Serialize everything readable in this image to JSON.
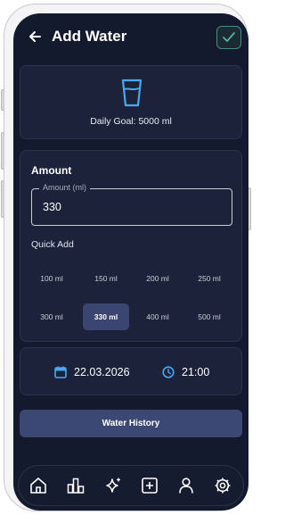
{
  "header": {
    "title": "Add Water",
    "back_icon": "arrow-left-icon",
    "confirm_icon": "check-icon"
  },
  "goal": {
    "icon": "water-glass-icon",
    "text": "Daily Goal: 5000 ml"
  },
  "amount": {
    "section_title": "Amount",
    "field_label": "Amount (ml)",
    "field_value": "330",
    "quick_add_label": "Quick Add",
    "quick_add_options": [
      "100 ml",
      "150 ml",
      "200 ml",
      "250 ml",
      "300 ml",
      "330 ml",
      "400 ml",
      "500 ml"
    ],
    "selected_option": "330 ml"
  },
  "datetime": {
    "date": "22.03.2026",
    "time": "21:00",
    "date_icon": "calendar-icon",
    "time_icon": "clock-icon"
  },
  "history_button": "Water History",
  "nav": {
    "items": [
      "home-icon",
      "stats-icon",
      "sparkle-icon",
      "add-square-icon",
      "profile-icon",
      "settings-icon"
    ]
  },
  "colors": {
    "background": "#131a2d",
    "card": "#1c2239",
    "accent_blue": "#4aa8f2",
    "confirm_green": "#4a8c80",
    "selected_chip": "#3a4571"
  }
}
